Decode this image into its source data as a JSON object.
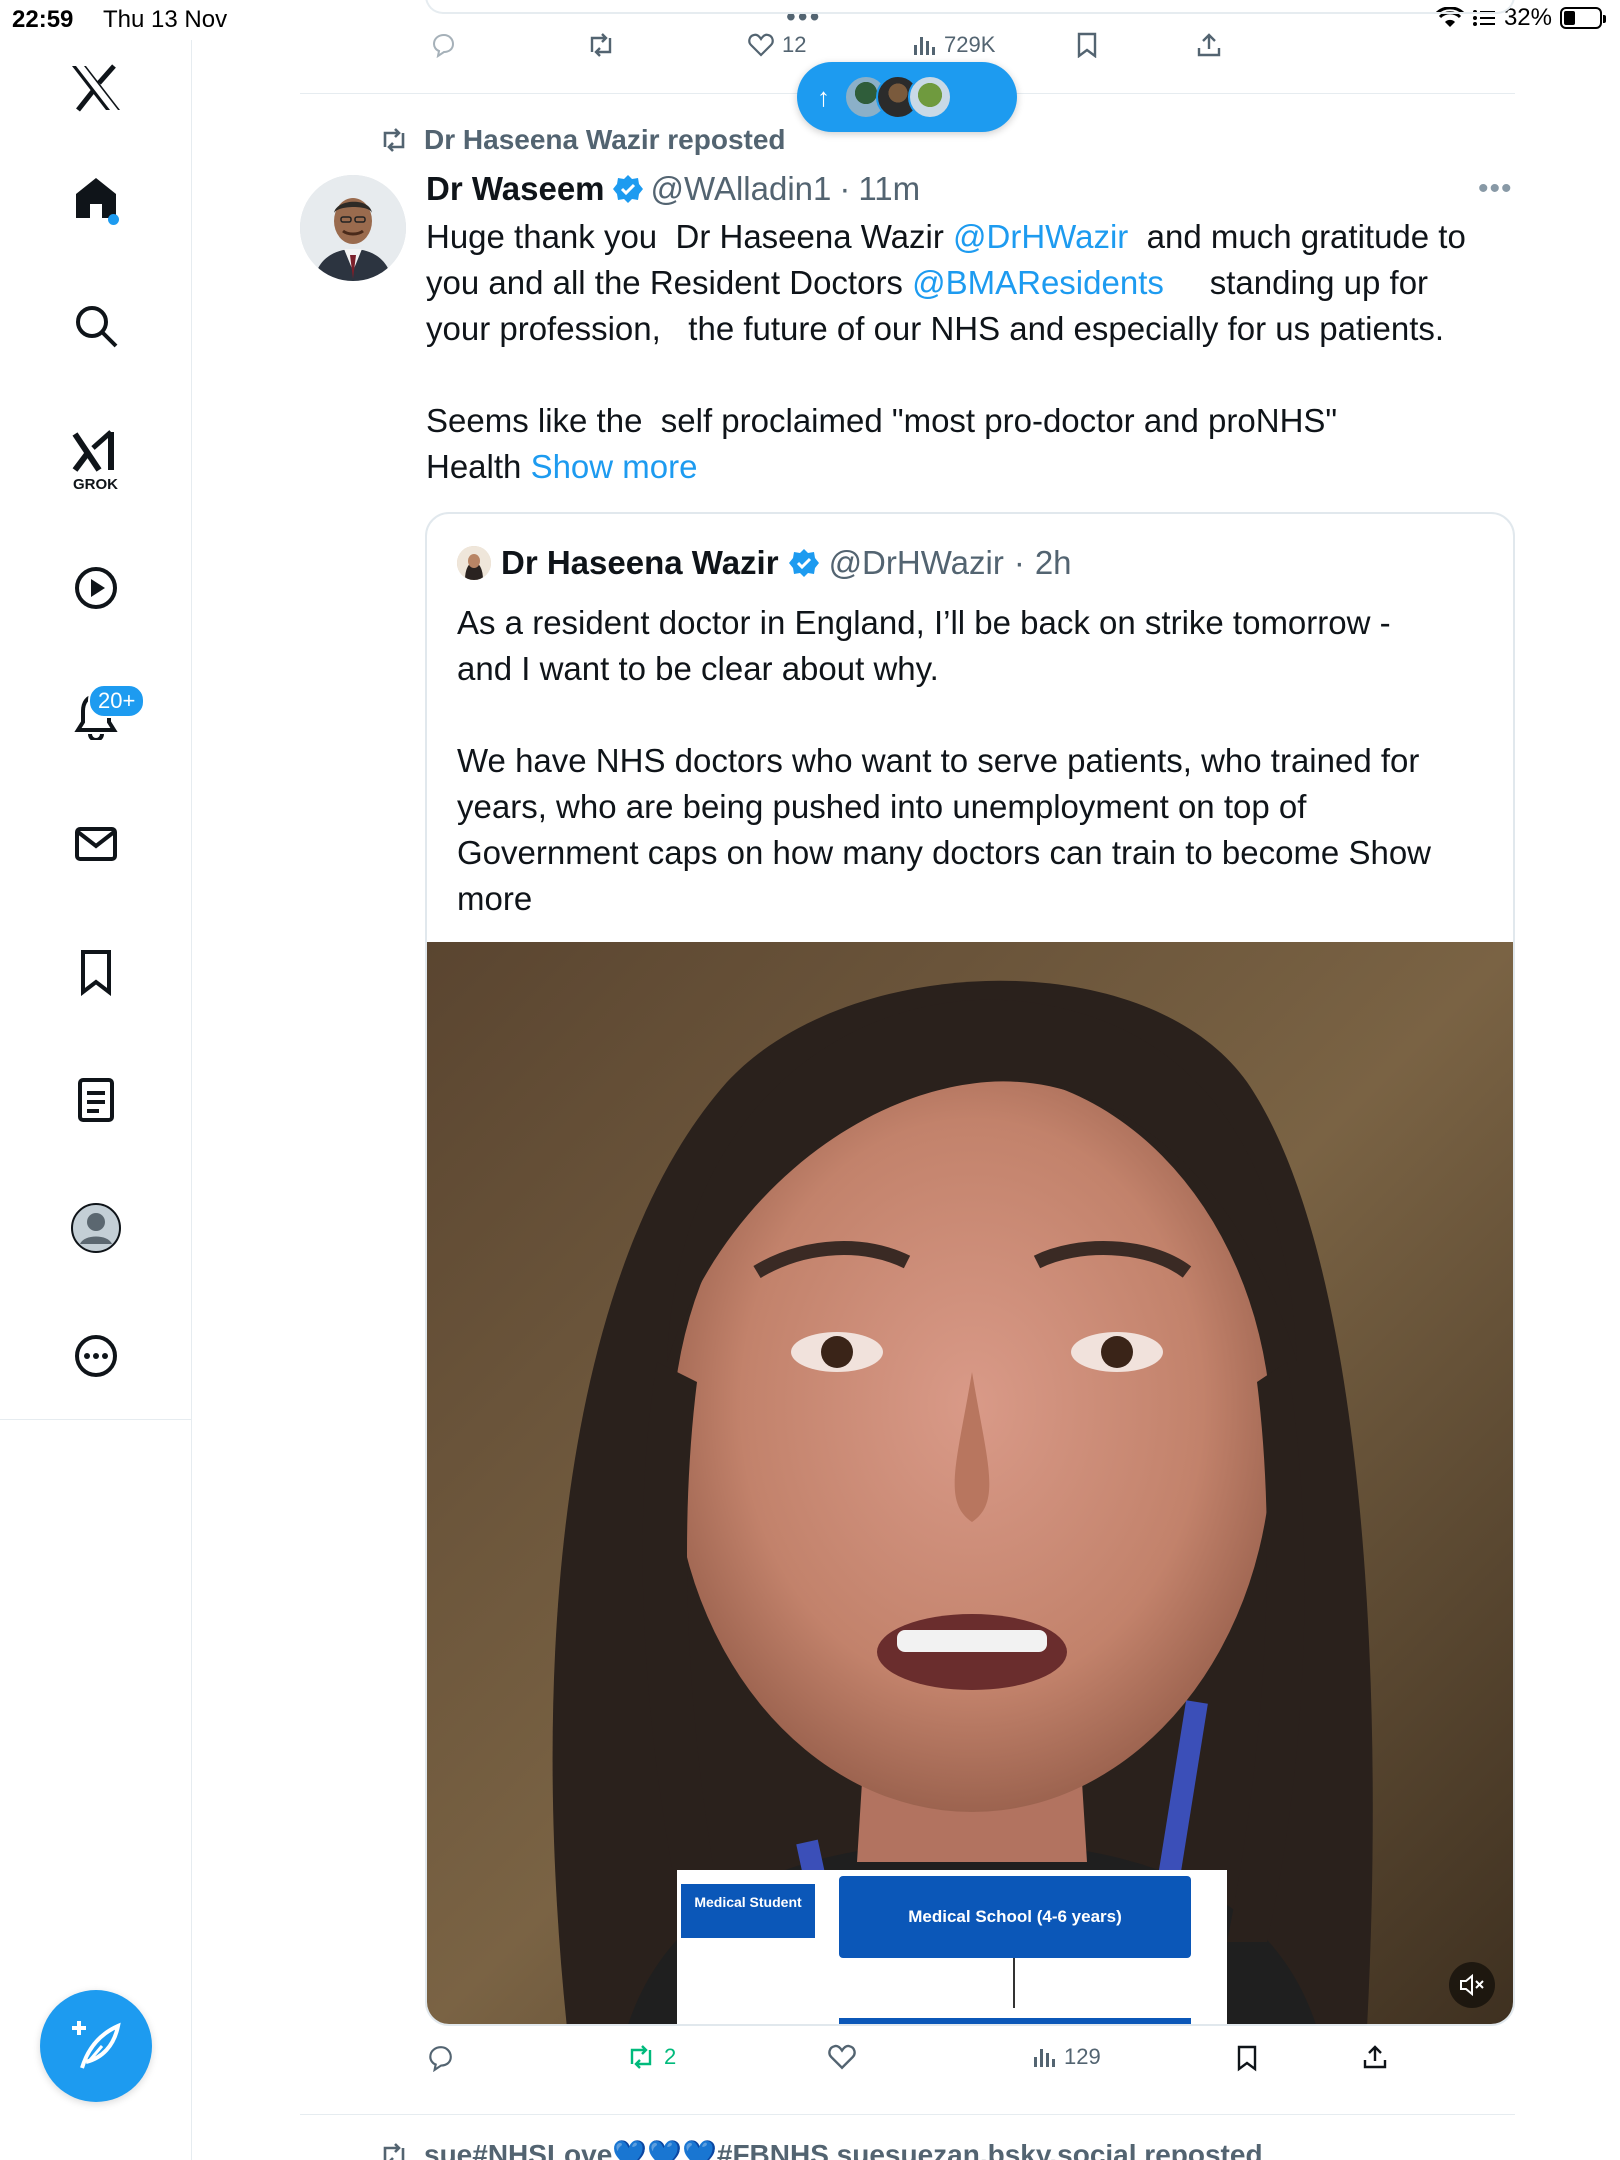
{
  "status_bar": {
    "time": "22:59",
    "date": "Thu 13 Nov",
    "battery": "32%",
    "battery_level": 0.32,
    "top_dots": "•••"
  },
  "sidebar": {
    "items": [
      {
        "name": "x-logo"
      },
      {
        "name": "home"
      },
      {
        "name": "search"
      },
      {
        "name": "grok",
        "label": "GROK"
      },
      {
        "name": "video"
      },
      {
        "name": "notifications",
        "badge": "20+"
      },
      {
        "name": "messages"
      },
      {
        "name": "bookmarks"
      },
      {
        "name": "lists"
      },
      {
        "name": "profile"
      },
      {
        "name": "more"
      }
    ]
  },
  "previous_tweet": {
    "likes": "12",
    "views": "729K"
  },
  "new_posts_pill": {
    "arrow": "↑",
    "avatar_colors": [
      "#3d6e8a",
      "#4a3f2e",
      "#5b7a3a"
    ]
  },
  "tweet": {
    "repost_by": "Dr Haseena Wazir reposted",
    "author_name": "Dr Waseem",
    "author_handle": "@WAlladin1",
    "time": "11m",
    "dot": "·",
    "more": "•••",
    "text_line1_a": "Huge thank you  Dr Haseena Wazir ",
    "text_line1_link": "@DrHWazir",
    "text_line1_b": "  and much gratitude to",
    "text_line2_a": "you and all the Resident Doctors ",
    "text_line2_link": "@BMAResidents",
    "text_line2_b": "     standing up for",
    "text_line3": "your profession,   the future of our NHS and especially for us patients.",
    "text_line4": "Seems like the  self proclaimed \"most pro-doctor and proNHS\"",
    "text_line5_a": "Health ",
    "show_more": "Show more"
  },
  "quote": {
    "author_name": "Dr Haseena Wazir",
    "author_handle": "@DrHWazir",
    "dot": "·",
    "time": "2h",
    "line1": "As a resident doctor in England, I’ll be back on strike tomorrow -",
    "line2": "and I want to be clear about why.",
    "line3": "We have NHS doctors who want to serve patients, who trained for",
    "line4": "years, who are being pushed into unemployment on top of",
    "line5": "Government caps on how many doctors can train to become Show",
    "line6": "more",
    "video_slide": {
      "box1": "Medical Student",
      "box2": "Medical School (4-6 years)"
    }
  },
  "tweet_actions": {
    "reposts": "2",
    "views": "129"
  },
  "next_tweet": {
    "repost_line": "sue#NHSLove💙💙💙#FBNHS suesuezan.bsky.social reposted"
  },
  "colors": {
    "accent": "#1d9bf0",
    "text": "#0f1419",
    "muted": "#536471",
    "repost_green": "#00ba7c"
  }
}
